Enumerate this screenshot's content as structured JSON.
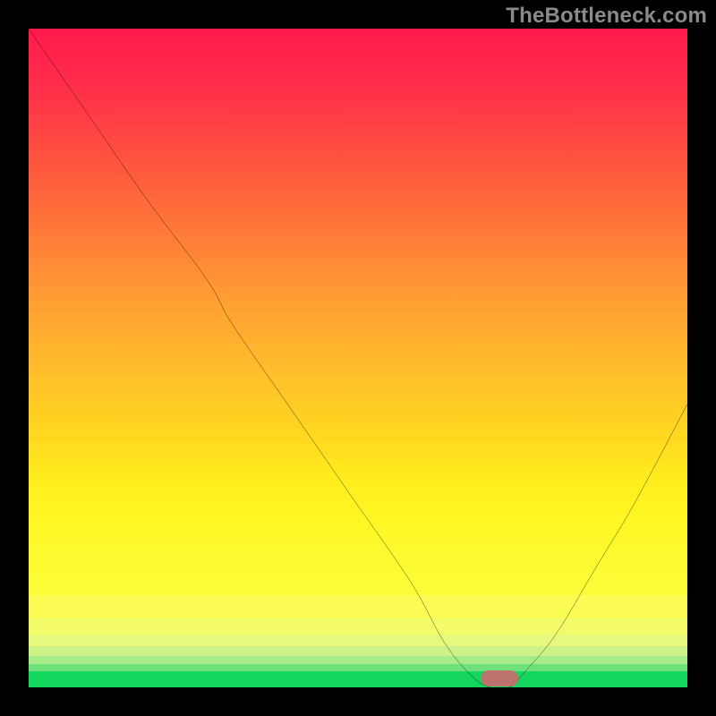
{
  "watermark": "TheBottleneck.com",
  "colors": {
    "frame": "#000000",
    "curve": "#000000",
    "marker": "#cc6a6f",
    "gradient_top": "#ff1a4c",
    "gradient_mid": "#ffd81f",
    "gradient_green": "#14d65e"
  },
  "chart_data": {
    "type": "line",
    "title": "",
    "xlabel": "",
    "ylabel": "",
    "xlim": [
      0,
      100
    ],
    "ylim": [
      0,
      100
    ],
    "x": [
      0,
      9,
      18,
      27,
      31,
      40,
      49,
      58,
      63,
      67,
      70,
      73,
      75,
      80,
      86,
      92,
      100
    ],
    "values": [
      100,
      87,
      74,
      62,
      55,
      42,
      29,
      16,
      7,
      2,
      0,
      0,
      2,
      8,
      18,
      28,
      43
    ],
    "marker": {
      "x": 71.5,
      "y": 1.3
    },
    "bands": [
      {
        "y_from": 14.0,
        "y_to": 10.5,
        "color": "#fbfd55"
      },
      {
        "y_from": 10.5,
        "y_to": 8.0,
        "color": "#f4fb6b"
      },
      {
        "y_from": 8.0,
        "y_to": 6.2,
        "color": "#e6f87e"
      },
      {
        "y_from": 6.2,
        "y_to": 4.8,
        "color": "#ccf288"
      },
      {
        "y_from": 4.8,
        "y_to": 3.6,
        "color": "#a6eb88"
      },
      {
        "y_from": 3.6,
        "y_to": 2.4,
        "color": "#6fe17a"
      },
      {
        "y_from": 2.4,
        "y_to": 0.0,
        "color": "#14d65e"
      }
    ]
  }
}
